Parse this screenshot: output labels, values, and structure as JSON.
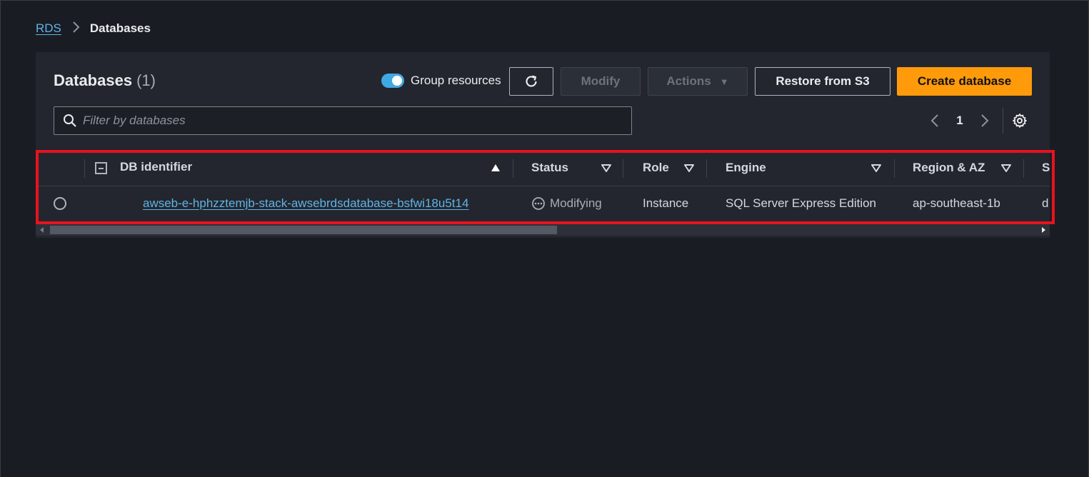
{
  "breadcrumb": {
    "root": "RDS",
    "separator": "›",
    "current": "Databases"
  },
  "header": {
    "title": "Databases",
    "count": "(1)"
  },
  "toolbar": {
    "group_resources_label": "Group resources",
    "group_resources_on": true,
    "modify_label": "Modify",
    "actions_label": "Actions",
    "restore_label": "Restore from S3",
    "create_label": "Create database"
  },
  "filter": {
    "placeholder": "Filter by databases",
    "value": ""
  },
  "pagination": {
    "current_page": "1"
  },
  "table": {
    "columns": {
      "db_identifier": "DB identifier",
      "status": "Status",
      "role": "Role",
      "engine": "Engine",
      "region": "Region & AZ",
      "size_truncated": "S"
    },
    "rows": [
      {
        "db_identifier": "awseb-e-hphzztemjb-stack-awsebrdsdatabase-bsfwi18u5t14",
        "status": "Modifying",
        "role": "Instance",
        "engine": "SQL Server Express Edition",
        "region": "ap-southeast-1b",
        "size_truncated": "d"
      }
    ]
  },
  "colors": {
    "background": "#1a1c24",
    "panel": "#23262e",
    "link": "#5fb4e6",
    "primary": "#ff9a0a",
    "toggle": "#3fa9e3",
    "highlight": "#e8121d"
  }
}
